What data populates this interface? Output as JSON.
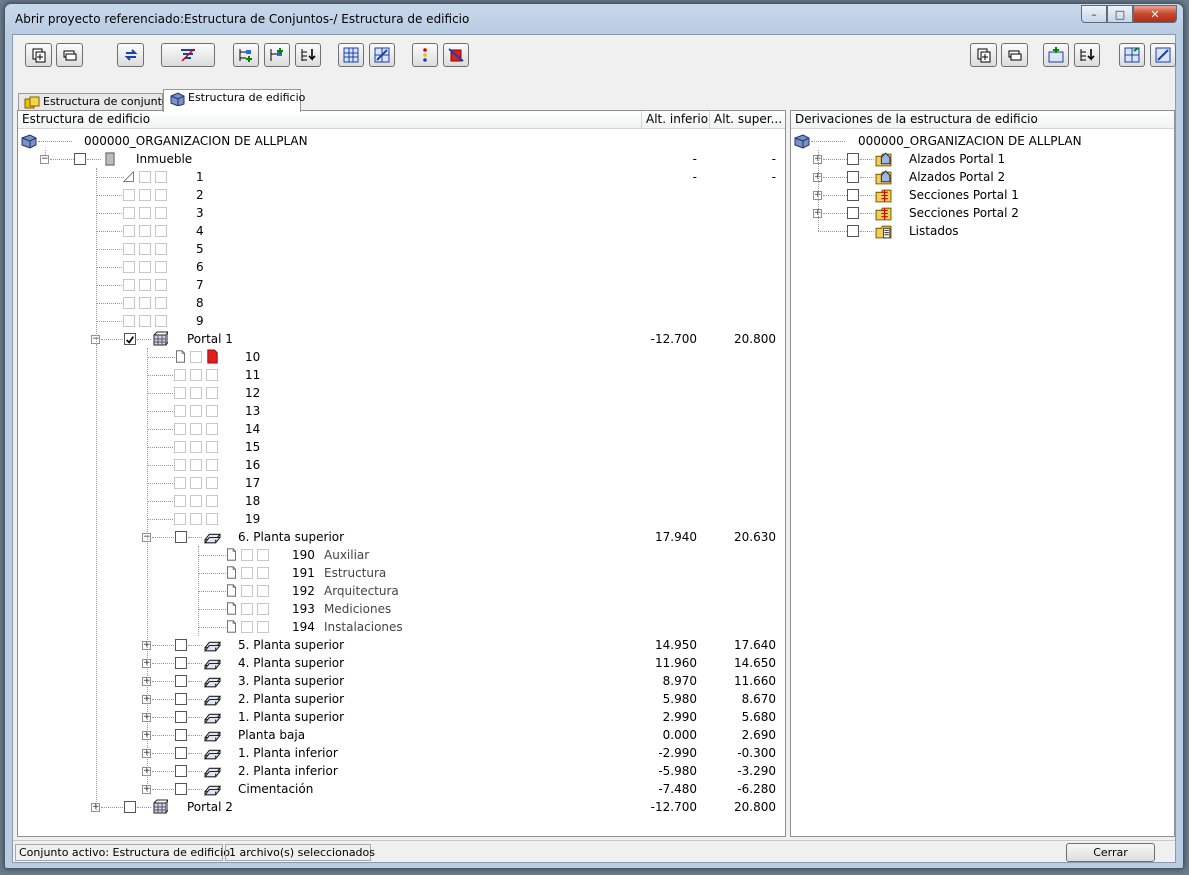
{
  "window": {
    "title": "Abrir proyecto referenciado:Estructura de Conjuntos-/ Estructura de edificio"
  },
  "colors": {
    "titlebar": "#b8cce2",
    "close": "#c7452b",
    "highlight_red": "#e0201c"
  },
  "toolbar": {
    "left_buttons": [
      "new-folder-icon",
      "rename-icon",
      "refresh-arrows-icon",
      "filter-icon",
      "add-structure-icon",
      "add-level-icon",
      "assign-icon",
      "level-grid-icon",
      "level-grid-2-icon",
      "color-dots-icon",
      "delete-red-icon"
    ],
    "right_buttons": [
      "new-folder-icon",
      "rename-icon",
      "add-derivation-icon",
      "assign-derivation-icon",
      "derive-icon",
      "derive-2-icon"
    ]
  },
  "tabs": [
    {
      "label": "Estructura de conjuntos",
      "icon": "sets-icon"
    },
    {
      "label": "Estructura de edificio",
      "icon": "building-icon",
      "active": true
    }
  ],
  "left": {
    "headers": [
      "Estructura de edificio",
      "Alt. inferior",
      "Alt. super..."
    ],
    "root": "000000_ORGANIZACION DE ALLPLAN",
    "inmueble": {
      "label": "Inmueble",
      "low": "-",
      "high": "-"
    },
    "files_top": [
      {
        "n": "1",
        "low": "-",
        "high": "-"
      },
      {
        "n": "2"
      },
      {
        "n": "3"
      },
      {
        "n": "4"
      },
      {
        "n": "5"
      },
      {
        "n": "6"
      },
      {
        "n": "7"
      },
      {
        "n": "8"
      },
      {
        "n": "9"
      }
    ],
    "portal1": {
      "label": "Portal 1",
      "low": "-12.700",
      "high": "20.800"
    },
    "portal1_files": [
      "10",
      "11",
      "12",
      "13",
      "14",
      "15",
      "16",
      "17",
      "18",
      "19"
    ],
    "planta6": {
      "label": "6. Planta superior",
      "low": "17.940",
      "high": "20.630"
    },
    "planta6_files": [
      {
        "n": "190",
        "name": "Auxiliar"
      },
      {
        "n": "191",
        "name": "Estructura"
      },
      {
        "n": "192",
        "name": "Arquitectura"
      },
      {
        "n": "193",
        "name": "Mediciones"
      },
      {
        "n": "194",
        "name": "Instalaciones"
      }
    ],
    "levels": [
      {
        "label": "5. Planta superior",
        "low": "14.950",
        "high": "17.640"
      },
      {
        "label": "4. Planta superior",
        "low": "11.960",
        "high": "14.650"
      },
      {
        "label": "3. Planta superior",
        "low": "8.970",
        "high": "11.660"
      },
      {
        "label": "2. Planta superior",
        "low": "5.980",
        "high": "8.670"
      },
      {
        "label": "1. Planta superior",
        "low": "2.990",
        "high": "5.680"
      },
      {
        "label": "Planta baja",
        "low": "0.000",
        "high": "2.690"
      },
      {
        "label": "1. Planta inferior",
        "low": "-2.990",
        "high": "-0.300"
      },
      {
        "label": "2. Planta inferior",
        "low": "-5.980",
        "high": "-3.290"
      },
      {
        "label": "Cimentación",
        "low": "-7.480",
        "high": "-6.280"
      }
    ],
    "portal2": {
      "label": "Portal 2",
      "low": "-12.700",
      "high": "20.800"
    }
  },
  "right": {
    "header": "Derivaciones de la estructura de edificio",
    "root": "000000_ORGANIZACION DE ALLPLAN",
    "items": [
      "Alzados Portal 1",
      "Alzados Portal 2",
      "Secciones Portal 1",
      "Secciones Portal 2",
      "Listados"
    ]
  },
  "status": {
    "active_set": "Conjunto activo: Estructura de edificio",
    "selected": "1 archivo(s) seleccionados",
    "close_label": "Cerrar"
  }
}
